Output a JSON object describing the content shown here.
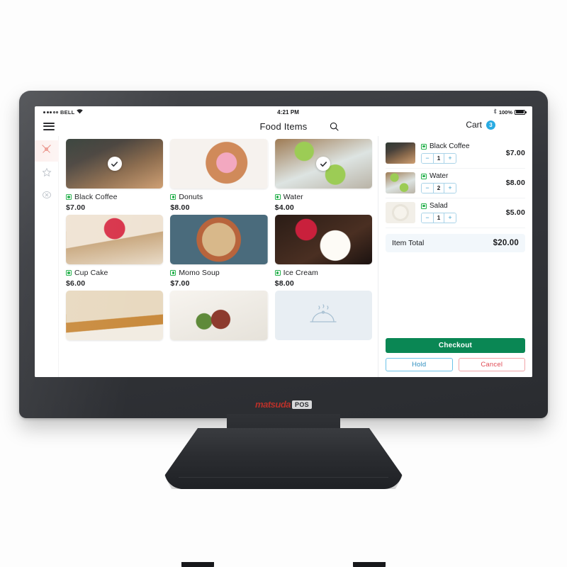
{
  "device": {
    "brand_name": "matsuda",
    "brand_suffix": "POS"
  },
  "status_bar": {
    "carrier": "BELL",
    "signal_dots_filled": 3,
    "signal_dots_total": 5,
    "wifi_icon": "wifi-icon",
    "time": "4:21 PM",
    "bluetooth_icon": "bluetooth-icon",
    "battery_percent": "100%"
  },
  "header": {
    "menu_icon": "hamburger-menu-icon",
    "title": "Food Items",
    "search_icon": "search-icon",
    "cart_label": "Cart",
    "cart_count": "3"
  },
  "sidebar": {
    "items": [
      {
        "name": "cutlery",
        "icon": "cutlery-icon",
        "active": true
      },
      {
        "name": "favorites",
        "icon": "star-icon",
        "active": false
      },
      {
        "name": "offers",
        "icon": "badge-icon",
        "active": false
      }
    ]
  },
  "food_grid": {
    "items": [
      {
        "label": "Black Coffee",
        "price": "$7.00",
        "veg": true,
        "selected": true,
        "image": "coffee-cup-photo"
      },
      {
        "label": "Donuts",
        "price": "$8.00",
        "veg": true,
        "selected": false,
        "image": "pink-donut-photo"
      },
      {
        "label": "Water",
        "price": "$4.00",
        "veg": true,
        "selected": true,
        "image": "kiwi-water-glass-photo"
      },
      {
        "label": "Cup Cake",
        "price": "$6.00",
        "veg": true,
        "selected": false,
        "image": "strawberry-cupcake-photo"
      },
      {
        "label": "Momo Soup",
        "price": "$7.00",
        "veg": true,
        "selected": false,
        "image": "momo-soup-bowl-photo"
      },
      {
        "label": "Ice Cream",
        "price": "$8.00",
        "veg": true,
        "selected": false,
        "image": "ice-cream-dessert-photo"
      },
      {
        "label": "",
        "price": "",
        "veg": false,
        "selected": false,
        "image": "pancake-stack-photo"
      },
      {
        "label": "",
        "price": "",
        "veg": false,
        "selected": false,
        "image": "plated-meat-dish-photo"
      },
      {
        "label": "",
        "price": "",
        "veg": false,
        "selected": false,
        "image": "placeholder-cloche-icon"
      }
    ]
  },
  "cart": {
    "items": [
      {
        "label": "Black Coffee",
        "qty": "1",
        "price": "$7.00",
        "veg": true,
        "image": "coffee-cup-photo"
      },
      {
        "label": "Water",
        "qty": "2",
        "price": "$8.00",
        "veg": true,
        "image": "kiwi-water-glass-photo"
      },
      {
        "label": "Salad",
        "qty": "1",
        "price": "$5.00",
        "veg": true,
        "image": "salad-plate-photo"
      }
    ],
    "decrement_label": "−",
    "increment_label": "+",
    "total_label": "Item Total",
    "total_value": "$20.00",
    "checkout_label": "Checkout",
    "hold_label": "Hold",
    "cancel_label": "Cancel"
  },
  "colors": {
    "accent_green": "#0a8754",
    "accent_blue": "#29abe2",
    "accent_red": "#e04a54",
    "veg_green": "#24b04b",
    "sidebar_active": "#e8857a"
  }
}
